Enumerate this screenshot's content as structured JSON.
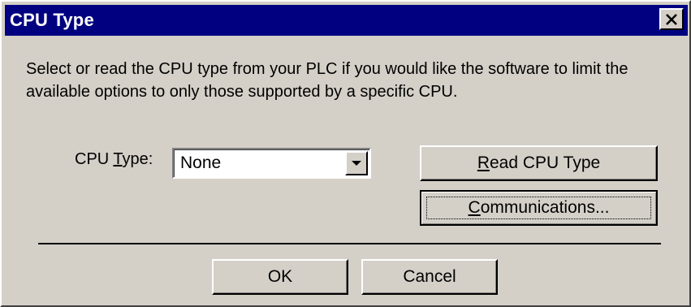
{
  "window": {
    "title": "CPU Type",
    "close_icon": "close-icon"
  },
  "message": "Select or read the CPU type from your PLC if you would like the software to limit the available options to only those supported by a specific CPU.",
  "cpu_type": {
    "label_prefix": "CPU ",
    "label_mnemonic": "T",
    "label_suffix": "ype:",
    "selected_value": "None"
  },
  "buttons": {
    "read_mnemonic": "R",
    "read_rest": "ead CPU Type",
    "comm_mnemonic": "C",
    "comm_rest": "ommunications...",
    "ok": "OK",
    "cancel": "Cancel"
  },
  "colors": {
    "titlebar": "#000080",
    "face": "#d4d0c8"
  }
}
